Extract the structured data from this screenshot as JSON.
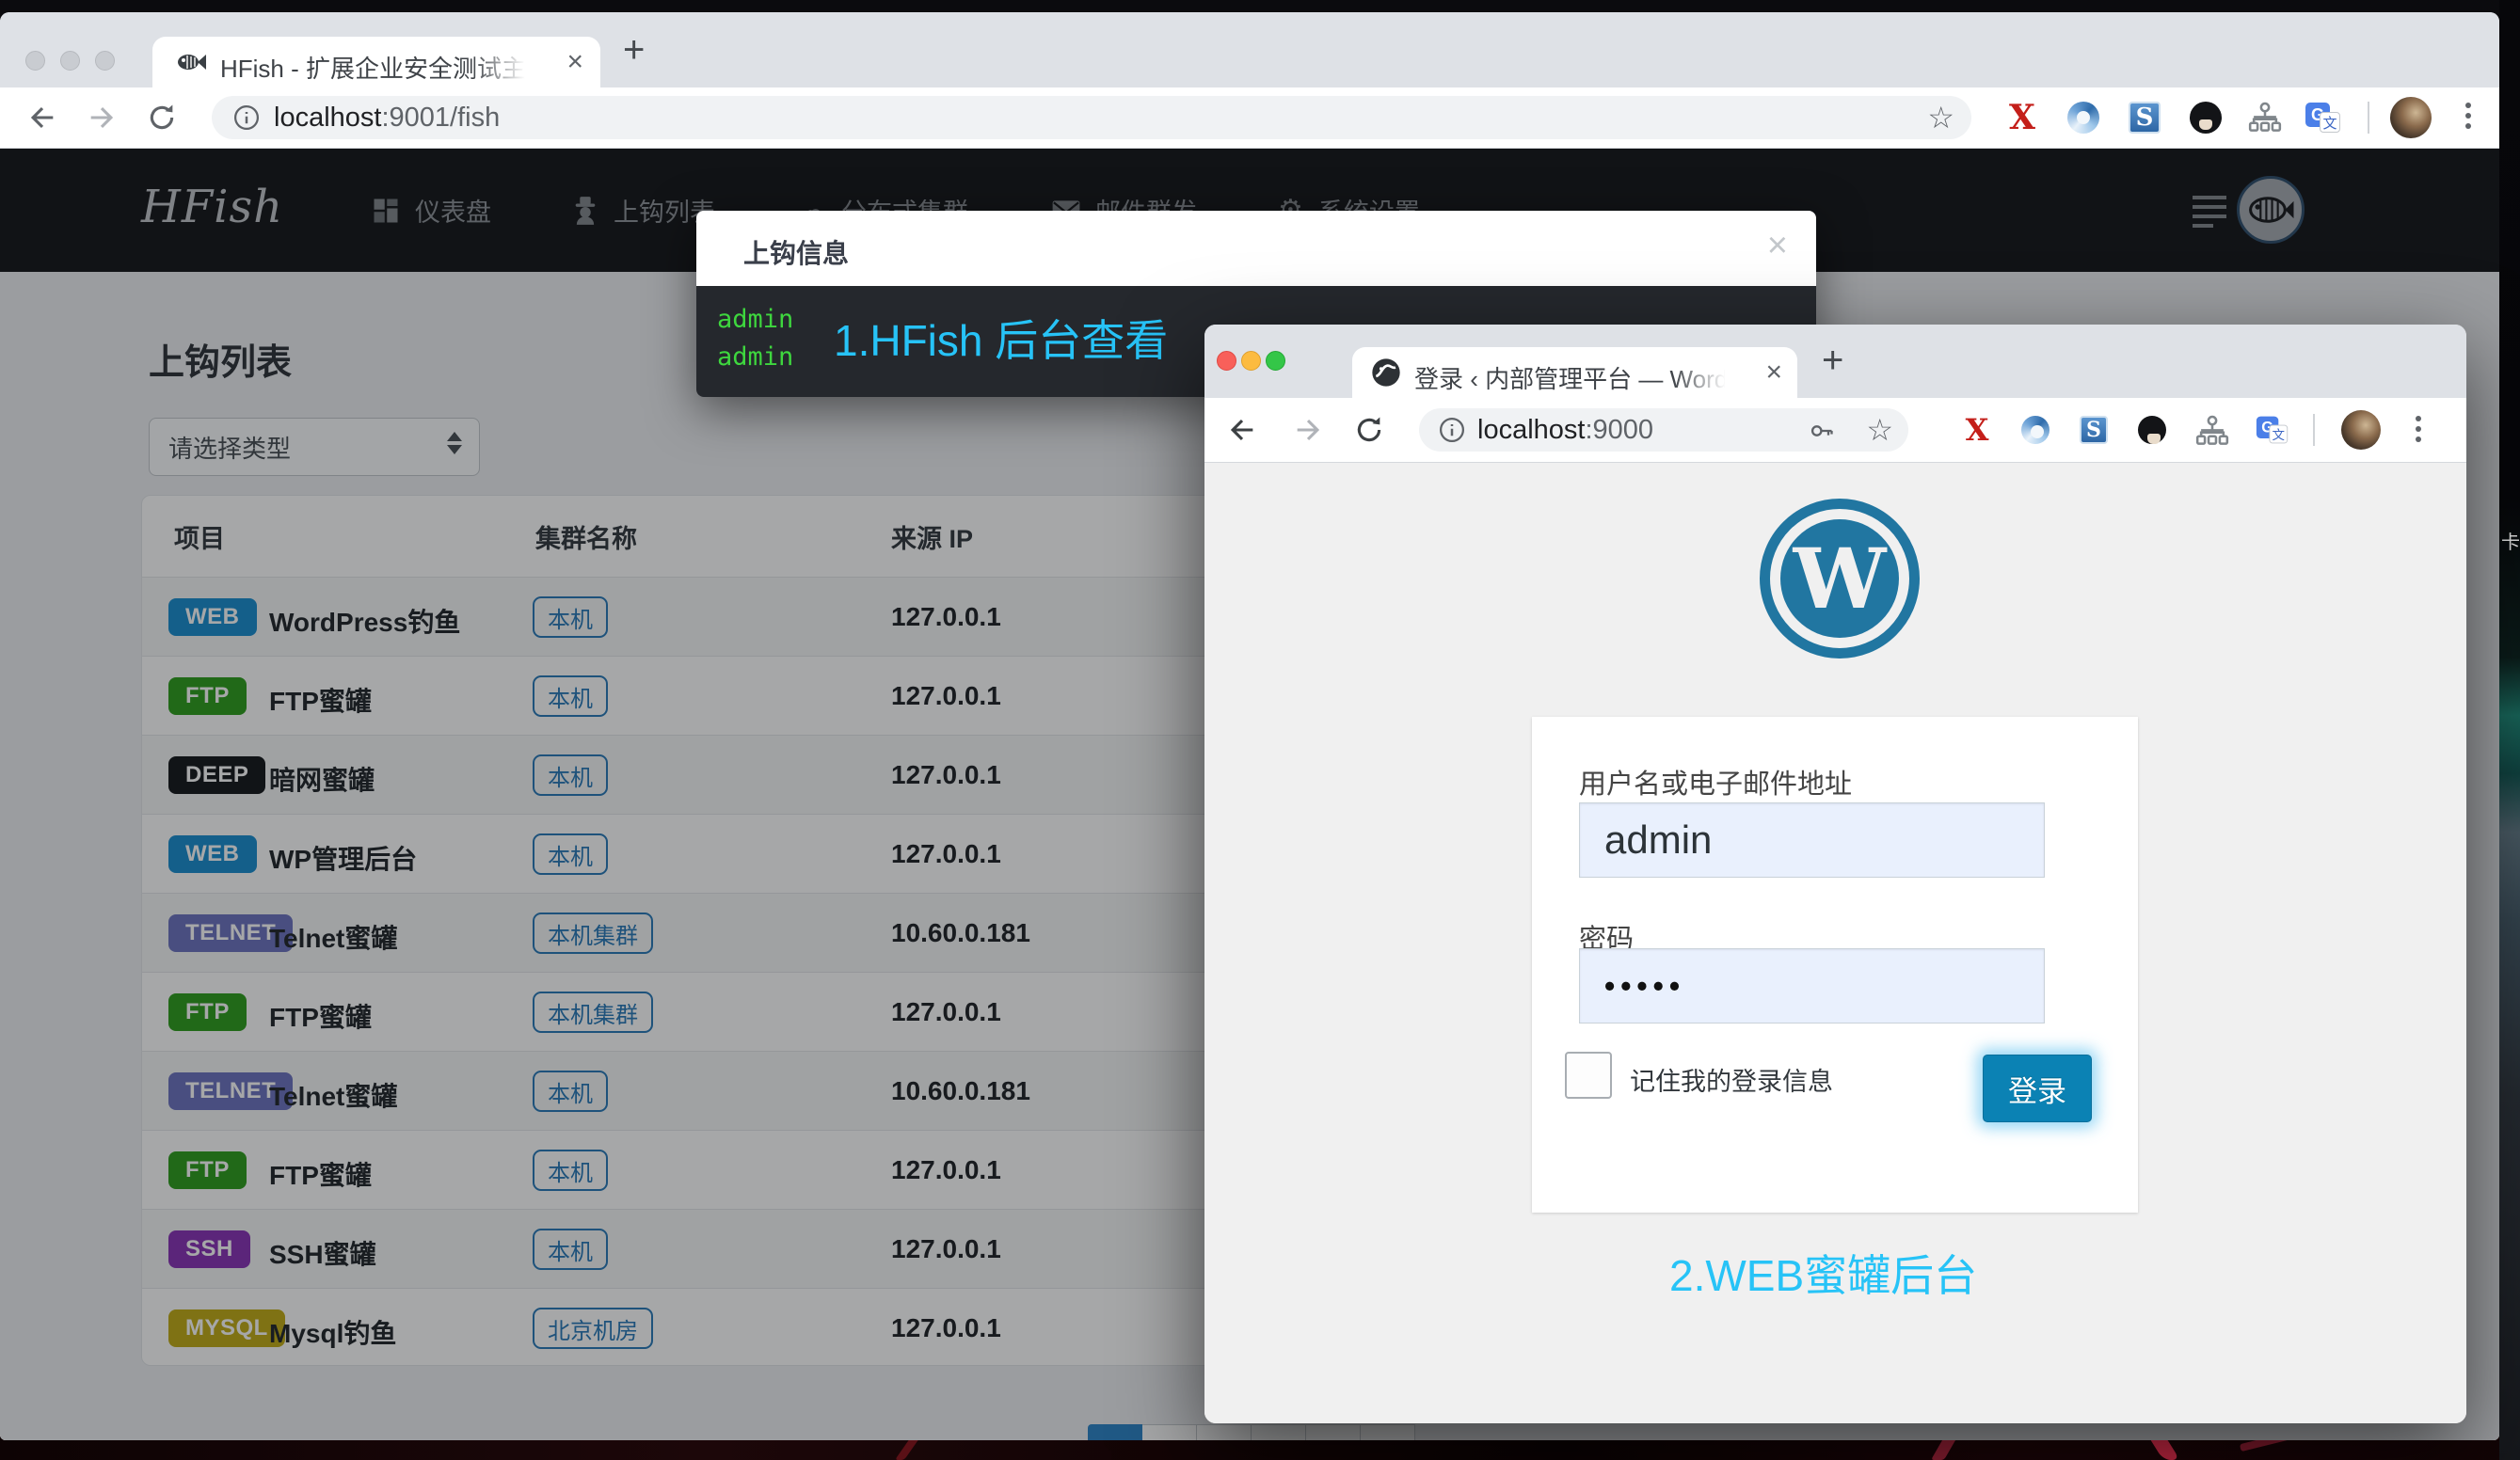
{
  "desktop": {
    "side_glyph": "卡",
    "accent_red": "#c22742",
    "annotation_color": "#27c3f7"
  },
  "annotations": {
    "step1": "1.HFish 后台查看",
    "step2": "2.WEB蜜罐后台"
  },
  "main_browser": {
    "tab_title": "HFish - 扩展企业安全测试主动诱",
    "tab_close": "×",
    "new_tab": "+",
    "url_host": "localhost",
    "url_rest": ":9001/fish",
    "bookmark_star": "☆"
  },
  "hfish": {
    "logo": "HFish",
    "nav": [
      {
        "label": "仪表盘"
      },
      {
        "label": "上钩列表"
      },
      {
        "label": "分布式集群"
      },
      {
        "label": "邮件群发"
      },
      {
        "label": "系统设置"
      }
    ],
    "page_title": "上钩列表",
    "type_filter": "请选择类型",
    "pager_active_color": "#2e85c8",
    "table": {
      "headers": [
        "项目",
        "集群名称",
        "来源 IP"
      ],
      "rows": [
        {
          "badge": "WEB",
          "badge_color": "#1c8fd1",
          "name": "WordPress钓鱼",
          "cluster": "本机",
          "ip": "127.0.0.1"
        },
        {
          "badge": "FTP",
          "badge_color": "#2f9e1e",
          "name": "FTP蜜罐",
          "cluster": "本机",
          "ip": "127.0.0.1"
        },
        {
          "badge": "DEEP",
          "badge_color": "#17191d",
          "name": "暗网蜜罐",
          "cluster": "本机",
          "ip": "127.0.0.1"
        },
        {
          "badge": "WEB",
          "badge_color": "#1c8fd1",
          "name": "WP管理后台",
          "cluster": "本机",
          "ip": "127.0.0.1"
        },
        {
          "badge": "TELNET",
          "badge_color": "#6e74c0",
          "name": "Telnet蜜罐",
          "cluster": "本机集群",
          "ip": "10.60.0.181"
        },
        {
          "badge": "FTP",
          "badge_color": "#2f9e1e",
          "name": "FTP蜜罐",
          "cluster": "本机集群",
          "ip": "127.0.0.1"
        },
        {
          "badge": "TELNET",
          "badge_color": "#6e74c0",
          "name": "Telnet蜜罐",
          "cluster": "本机",
          "ip": "10.60.0.181"
        },
        {
          "badge": "FTP",
          "badge_color": "#2f9e1e",
          "name": "FTP蜜罐",
          "cluster": "本机",
          "ip": "127.0.0.1"
        },
        {
          "badge": "SSH",
          "badge_color": "#8a35b8",
          "name": "SSH蜜罐",
          "cluster": "本机",
          "ip": "127.0.0.1"
        },
        {
          "badge": "MYSQL",
          "badge_color": "#c2ad18",
          "name": "Mysql钓鱼",
          "cluster": "北京机房",
          "ip": "127.0.0.1"
        }
      ]
    },
    "modal": {
      "title": "上钩信息",
      "close": "×",
      "lines": [
        "admin",
        "admin"
      ],
      "terminal_text_color": "#3ed63e"
    }
  },
  "wp_browser": {
    "tab_title": "登录 ‹ 内部管理平台 — WordPre",
    "tab_close": "×",
    "new_tab": "+",
    "url_host": "localhost",
    "url_rest": ":9000",
    "bookmark_star": "☆",
    "login": {
      "logo_letter": "W",
      "username_label": "用户名或电子邮件地址",
      "username_value": "admin",
      "password_label": "密码",
      "password_value": "•••••",
      "remember_label": "记住我的登录信息",
      "login_button": "登录",
      "button_color": "#0b82b4"
    }
  }
}
